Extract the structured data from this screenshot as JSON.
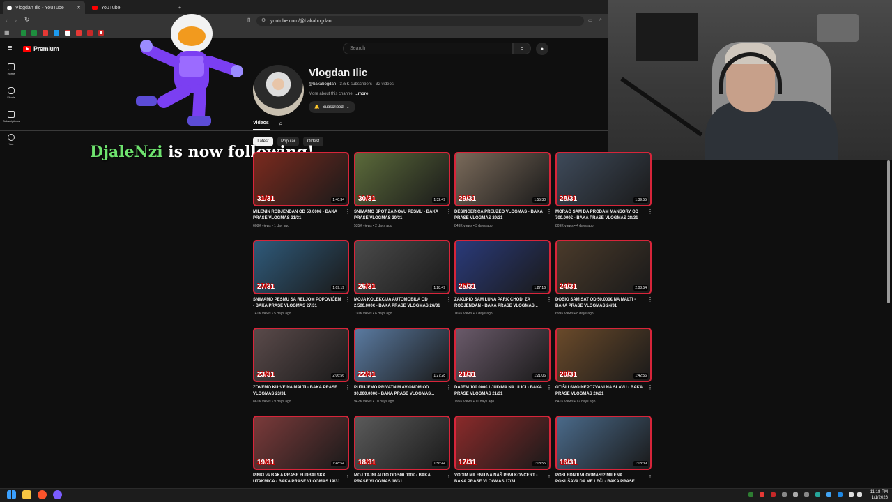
{
  "browser": {
    "tabs": [
      {
        "label": "Vlogdan Ilic - YouTube",
        "active": true
      },
      {
        "label": "YouTube",
        "active": false
      }
    ],
    "url": "youtube.com/@bakabogdan"
  },
  "youtube": {
    "logo_text": "Premium",
    "search_placeholder": "Search",
    "guide": [
      {
        "label": "Home",
        "icon": "home-icon"
      },
      {
        "label": "Shorts",
        "icon": "shorts-icon"
      },
      {
        "label": "Subscriptions",
        "icon": "subscriptions-icon"
      },
      {
        "label": "You",
        "icon": "you-icon"
      }
    ]
  },
  "channel": {
    "name": "Vlogdan Ilic",
    "handle": "@bakabogdan",
    "stats": "· 375K subscribers · 32 videos",
    "desc": "More about this channel",
    "desc_more": "...more",
    "subscribed_label": "Subscribed",
    "tab_videos": "Videos",
    "chips": [
      "Latest",
      "Popular",
      "Oldest"
    ]
  },
  "videos": [
    {
      "title": "MILENIN RODJENDAN OD 50.000€ - BAKA PRASE VLOGMAS 31/31",
      "views": "608K views",
      "age": "1 day ago",
      "duration": "1:40:34",
      "ep": "31/31",
      "bg": "#7a2a1e"
    },
    {
      "title": "SNIMAMO SPOT ZA NOVU PESMU - BAKA PRASE VLOGMAS 30/31",
      "views": "535K views",
      "age": "2 days ago",
      "duration": "1:32:49",
      "ep": "30/31",
      "bg": "#5b6a3a"
    },
    {
      "title": "DESINGERICA PREUZEO VLOGMAS - BAKA PRASE VLOGMAS 29/31",
      "views": "843K views",
      "age": "3 days ago",
      "duration": "1:55:30",
      "ep": "29/31",
      "bg": "#7a6a5a"
    },
    {
      "title": "MORAO SAM DA PRODAM MANSORY OD 700.000€ - BAKA PRASE VLOGMAS 28/31",
      "views": "809K views",
      "age": "4 days ago",
      "duration": "1:39:55",
      "ep": "28/31",
      "bg": "#3e4a5a"
    },
    {
      "title": "SNIMAMO PESMU SA RELJOM POPOVIĆEM - BAKA PRASE VLOGMAS 27/31",
      "views": "741K views",
      "age": "5 days ago",
      "duration": "1:09:19",
      "ep": "27/31",
      "bg": "#2f5a7a"
    },
    {
      "title": "MOJA KOLEKCIJA AUTOMOBILA OD 2.500.000€ - BAKA PRASE VLOGMAS 26/31",
      "views": "730K views",
      "age": "6 days ago",
      "duration": "1:28:49",
      "ep": "26/31",
      "bg": "#4a4a4a"
    },
    {
      "title": "ZAKUPIO SAM LUNA PARK CHODI ZA RODJENDAN - BAKA PRASE VLOGMAS...",
      "views": "765K views",
      "age": "7 days ago",
      "duration": "1:27:16",
      "ep": "25/31",
      "bg": "#2a3a7a"
    },
    {
      "title": "DOBIO SAM SAT OD 50.000€ NA MALTI - BAKA PRASE VLOGMAS 24/31",
      "views": "699K views",
      "age": "8 days ago",
      "duration": "2:08:54",
      "ep": "24/31",
      "bg": "#4a3a2a"
    },
    {
      "title": "ZOVEMO KU*VE NA MALTI - BAKA PRASE VLOGMAS 23/31",
      "views": "861K views",
      "age": "9 days ago",
      "duration": "2:06:56",
      "ep": "23/31",
      "bg": "#5a4a4a"
    },
    {
      "title": "PUTUJEMO PRIVATNIM AVIONOM OD 30.000.000€ - BAKA PRASE VLOGMAS...",
      "views": "942K views",
      "age": "10 days ago",
      "duration": "1:27:28",
      "ep": "22/31",
      "bg": "#5a7aa0"
    },
    {
      "title": "DAJEM 100.000€ LJUDIMA NA ULICI - BAKA PRASE VLOGMAS 21/31",
      "views": "795K views",
      "age": "11 days ago",
      "duration": "1:21:06",
      "ep": "21/31",
      "bg": "#6a5a6a"
    },
    {
      "title": "OTIŠLI SMO NEPOZVANI NA SLAVU - BAKA PRASE VLOGMAS 20/31",
      "views": "841K views",
      "age": "12 days ago",
      "duration": "1:42:56",
      "ep": "20/31",
      "bg": "#6a4a2a"
    },
    {
      "title": "PINKI vs BAKA PRASE FUDBALSKA UTAKMICA - BAKA PRASE VLOGMAS 19/31",
      "views": "",
      "age": "",
      "duration": "1:48:54",
      "ep": "19/31",
      "bg": "#7a3a3a"
    },
    {
      "title": "MOJ TAJNI AUTO OD 500.000€ - BAKA PRASE VLOGMAS 18/31",
      "views": "",
      "age": "",
      "duration": "1:56:44",
      "ep": "18/31",
      "bg": "#5a5a5a"
    },
    {
      "title": "VODIM MILENU NA NAŠ PRVI KONCERT - BAKA PRASE VLOGMAS 17/31",
      "views": "",
      "age": "",
      "duration": "1:18:55",
      "ep": "17/31",
      "bg": "#8a2a2a"
    },
    {
      "title": "POSLEDNJI VLOGMAS!? MILENA POKUŠAVA DA ME LEČI - BAKA PRASE...",
      "views": "",
      "age": "",
      "duration": "1:18:39",
      "ep": "16/31",
      "bg": "#4a6a8a"
    }
  ],
  "overlay": {
    "follower": "DjaleNzi",
    "follow_text": " is now following!"
  },
  "taskbar": {
    "time": "11:18 PM",
    "date": "1/1/2026"
  },
  "colors": {
    "background": "#0f0f0f",
    "accent_red": "#ff0000",
    "follower_green": "#6ee26e"
  }
}
